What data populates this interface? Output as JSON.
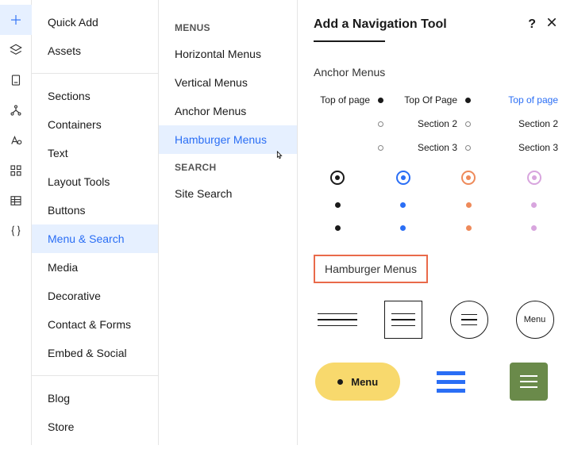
{
  "rail": {
    "active_index": 0
  },
  "categories": {
    "groups": [
      {
        "items": [
          {
            "label": "Quick Add"
          },
          {
            "label": "Assets"
          }
        ]
      },
      {
        "items": [
          {
            "label": "Sections"
          },
          {
            "label": "Containers"
          },
          {
            "label": "Text"
          },
          {
            "label": "Layout Tools"
          },
          {
            "label": "Buttons"
          },
          {
            "label": "Menu & Search",
            "active": true
          },
          {
            "label": "Media"
          },
          {
            "label": "Decorative"
          },
          {
            "label": "Contact & Forms"
          },
          {
            "label": "Embed & Social"
          }
        ]
      },
      {
        "items": [
          {
            "label": "Blog"
          },
          {
            "label": "Store"
          }
        ]
      }
    ]
  },
  "submenu": {
    "sections": [
      {
        "header": "MENUS",
        "items": [
          {
            "label": "Horizontal Menus"
          },
          {
            "label": "Vertical Menus"
          },
          {
            "label": "Anchor Menus"
          },
          {
            "label": "Hamburger Menus",
            "active": true
          }
        ]
      },
      {
        "header": "SEARCH",
        "items": [
          {
            "label": "Site Search"
          }
        ]
      }
    ]
  },
  "panel": {
    "title": "Add a Navigation Tool",
    "anchor_section_title": "Anchor Menus",
    "hamburger_section_title": "Hamburger Menus",
    "anchor_labels": {
      "top1": "Top of page",
      "top2": "Top Of Page",
      "top3": "Top of page",
      "sec2": "Section 2",
      "sec3": "Section 3"
    },
    "dot_colors": [
      "#1a1a1a",
      "#2a6ef5",
      "#ee8a5a",
      "#d8a5de"
    ],
    "hamburger_text": "Menu",
    "pill_text": "Menu"
  }
}
